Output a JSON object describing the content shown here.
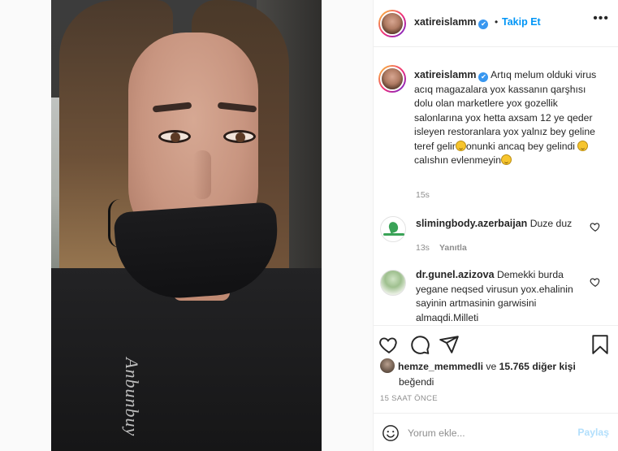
{
  "post": {
    "username": "xatireislamm",
    "verified_mark": "✔",
    "separator": "•",
    "follow_label": "Takip Et",
    "more_label": "•••"
  },
  "caption": {
    "username": "xatireislamm",
    "text_part1": "Artıq melum olduki virus acıq magazalara yox kassanın qarşhısı dolu olan marketlere yox gozellik salonlarına yox hetta axsam 12 ye qeder isleyen restoranlara yox yalnız bey geline teref gelir",
    "text_part2": "onunki ancaq bey gelindi",
    "text_part3": "calıshın evlenmeyin",
    "time": "15s"
  },
  "comments": [
    {
      "username": "slimingbody.azerbaijan",
      "text": "Duze duz",
      "time": "13s",
      "reply_label": "Yanıtla"
    },
    {
      "username": "dr.gunel.azizova",
      "text": "Demekki burda yegane neqsed virusun yox.ehalinin sayinin artmasinin garwisini almaqdi.Milleti"
    }
  ],
  "likes": {
    "liker": "hemze_memmedli",
    "conjunction": "ve",
    "count_text": "15.765 diğer kişi",
    "suffix": "beğendi"
  },
  "timestamp": "15 SAAT ÖNCE",
  "add_comment": {
    "placeholder": "Yorum ekle...",
    "post_label": "Paylaş"
  },
  "photo": {
    "shirt_text": "Anbunbuy"
  },
  "colors": {
    "link_blue": "#0095f6",
    "verified_blue": "#3897f0",
    "muted_gray": "#8e8e8e",
    "disabled_post": "#b2dffc",
    "text": "#262626"
  },
  "icons": [
    "heart-icon",
    "comment-icon",
    "share-icon",
    "bookmark-icon",
    "emoji-icon",
    "more-icon",
    "verified-icon"
  ]
}
